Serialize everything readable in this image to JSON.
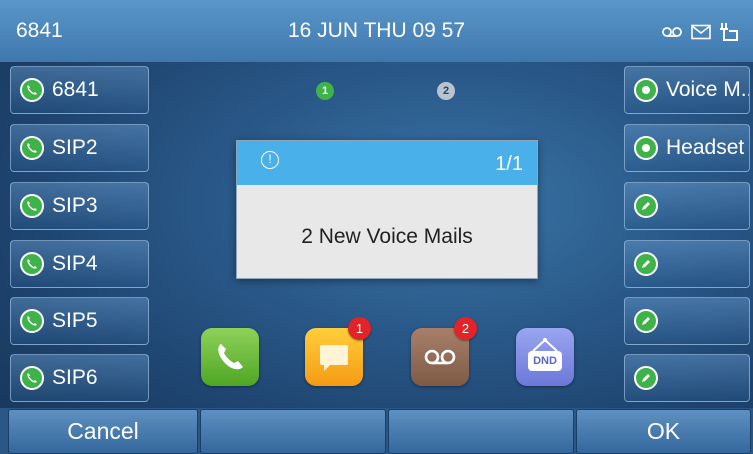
{
  "status_bar": {
    "extension": "6841",
    "datetime": "16 JUN THU  09 57",
    "icons": [
      "voicemail-icon",
      "message-icon",
      "network-icon"
    ]
  },
  "page_indicator": [
    "1",
    "2"
  ],
  "left_line_keys": [
    {
      "label": "6841",
      "icon": "phone-icon"
    },
    {
      "label": "SIP2",
      "icon": "phone-icon"
    },
    {
      "label": "SIP3",
      "icon": "phone-icon"
    },
    {
      "label": "SIP4",
      "icon": "phone-icon"
    },
    {
      "label": "SIP5",
      "icon": "phone-icon"
    },
    {
      "label": "SIP6",
      "icon": "phone-icon"
    }
  ],
  "right_line_keys": [
    {
      "label": "Voice M..",
      "icon": "dot-icon"
    },
    {
      "label": "Headset",
      "icon": "dot-icon"
    },
    {
      "label": "",
      "icon": "edit-icon"
    },
    {
      "label": "",
      "icon": "edit-icon"
    },
    {
      "label": "",
      "icon": "edit-icon"
    },
    {
      "label": "",
      "icon": "edit-icon"
    }
  ],
  "popup": {
    "page": "1/1",
    "info_glyph": "!",
    "message": "2 New Voice Mails"
  },
  "apps": [
    {
      "name": "phone-app",
      "badge": ""
    },
    {
      "name": "messages-app",
      "badge": "1"
    },
    {
      "name": "voicemail-app",
      "badge": "2"
    },
    {
      "name": "dnd-app",
      "badge": "",
      "label": "DND"
    }
  ],
  "softkeys": [
    "Cancel",
    "",
    "",
    "OK"
  ],
  "colors": {
    "status_bar": "#4a86bc",
    "popup_header": "#49b0ea",
    "line_icon_green": "#3fb24a",
    "badge_red": "#e2232a"
  }
}
